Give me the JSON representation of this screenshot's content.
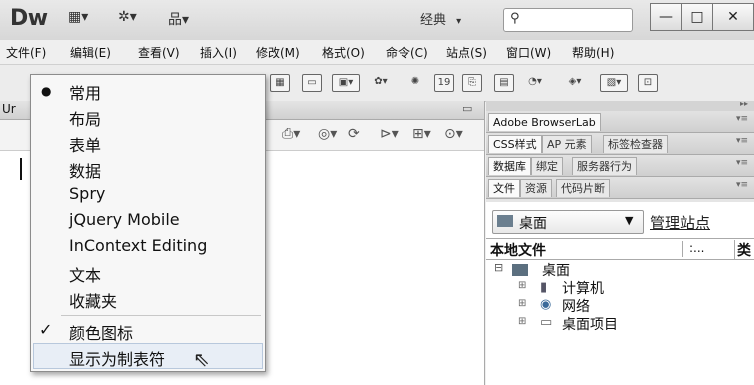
{
  "app": {
    "logo": "Dw",
    "layout_label": "经典",
    "layout_arrow": "▾",
    "search_placeholder": ""
  },
  "title_buttons": [
    {
      "name": "layout-icon-dd",
      "glyph": "▦▾"
    },
    {
      "name": "extensions-icon-dd",
      "glyph": "✲▾"
    },
    {
      "name": "site-icon-dd",
      "glyph": "品▾"
    }
  ],
  "window_controls": {
    "minimize": "—",
    "maximize": "□",
    "close": "✕"
  },
  "menubar": [
    "文件(F)",
    "编辑(E)",
    "查看(V)",
    "插入(I)",
    "修改(M)",
    "格式(O)",
    "命令(C)",
    "站点(S)",
    "窗口(W)",
    "帮助(H)"
  ],
  "doc_tab_partial": "Ur",
  "insert_menu": {
    "items": [
      "常用",
      "布局",
      "表单",
      "数据",
      "Spry",
      "jQuery Mobile",
      "InContext Editing",
      "文本",
      "收藏夹"
    ],
    "selected_index": 0,
    "selected_mark": "●",
    "color_icons_label": "颜色图标",
    "color_icons_check": "✓",
    "show_as_tabs_label": "显示为制表符"
  },
  "panels": {
    "browserlab": "Adobe BrowserLab",
    "row1": [
      "CSS样式",
      "AP 元素",
      "标签检查器"
    ],
    "row2": [
      "数据库",
      "绑定",
      "服务器行为"
    ],
    "row3": [
      "文件",
      "资源",
      "代码片断"
    ],
    "collapse_glyph": "▸▸",
    "menu_glyph": "▾≡"
  },
  "files": {
    "location": "桌面",
    "manage_sites": "管理站点",
    "col_local": "本地文件",
    "col_dots": ":...",
    "col_type": "类",
    "root": "桌面",
    "children": [
      "计算机",
      "网络",
      "桌面项目"
    ]
  }
}
